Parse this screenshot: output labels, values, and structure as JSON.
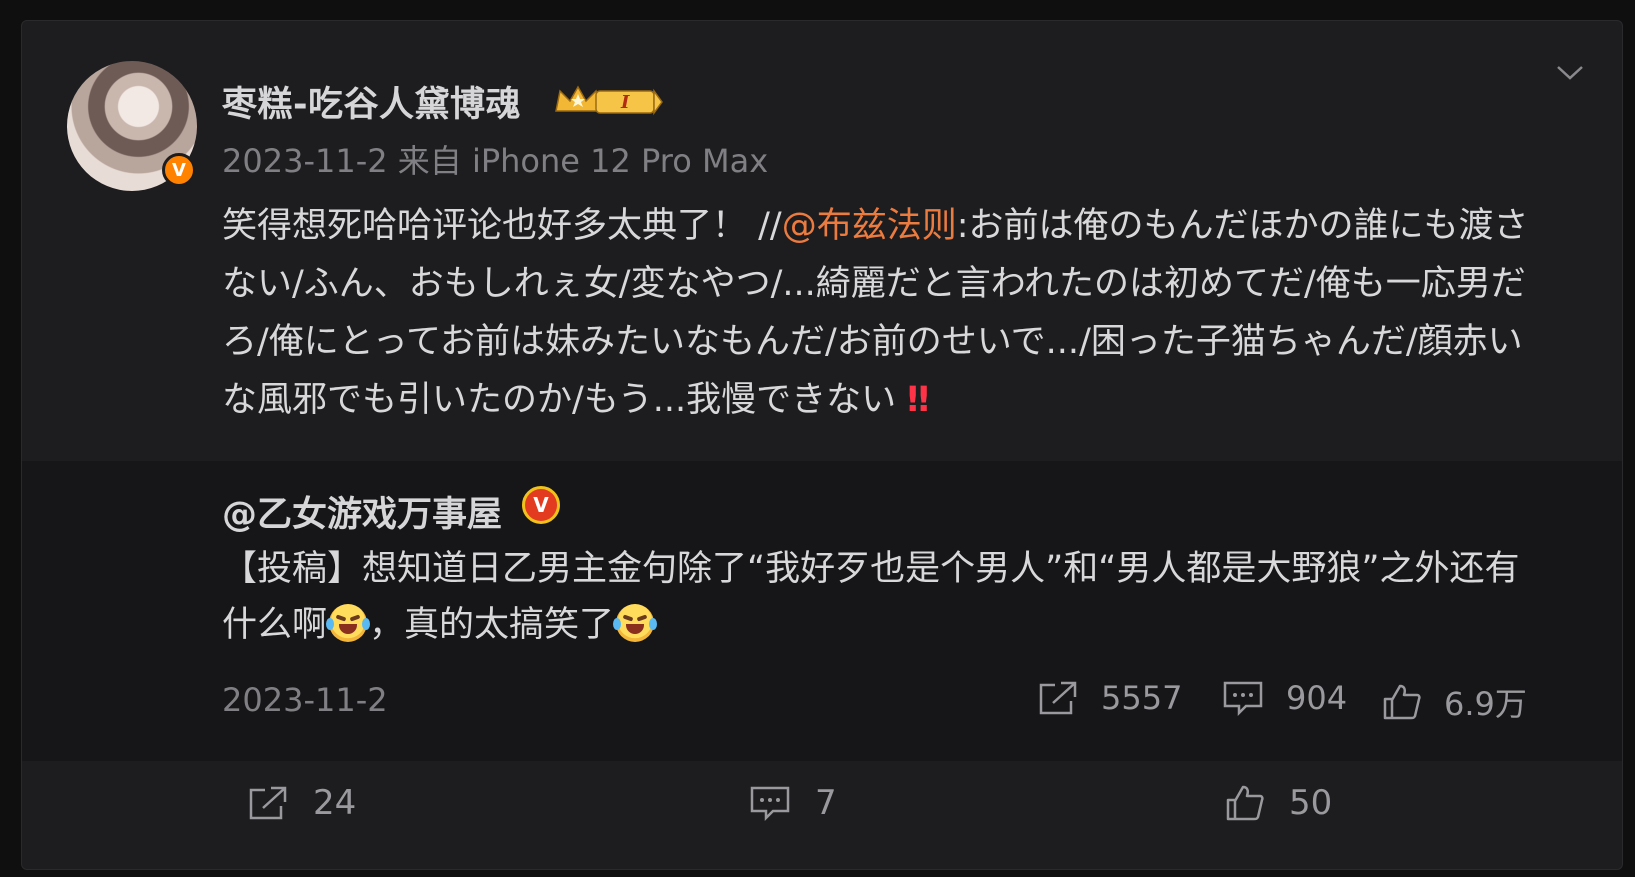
{
  "post": {
    "username": "枣糕-吃谷人黛博魂",
    "meta": "2023-11-2 来自 iPhone 12 Pro Max",
    "text_before": "笑得想死哈哈评论也好多太典了！ //",
    "mention": "@布兹法则",
    "text_after": ":お前は俺のもんだほかの誰にも渡さない/ふん、おもしれぇ女/変なやつ/...綺麗だと言われたのは初めてだ/俺も一応男だろ/俺にとってお前は妹みたいなもんだ/お前のせいで.../困った子猫ちゃんだ/顔赤いな風邪でも引いたのか/もう...我慢できない ",
    "emphasis": "‼"
  },
  "repost": {
    "username": "@乙女游戏万事屋",
    "text_part1": "【投稿】想知道日乙男主金句除了“我好歹也是个男人”和“男人都是大野狼”之外还有什么啊",
    "text_part2": "，真的太搞笑了",
    "date": "2023-11-2",
    "shares": "5557",
    "comments": "904",
    "likes": "6.9万"
  },
  "actions": {
    "shares": "24",
    "comments": "7",
    "likes": "50"
  },
  "icons": [
    "verified-badge-icon",
    "vip-crown-icon",
    "chevron-down-icon",
    "share-icon",
    "comment-icon",
    "like-icon",
    "laughing-emoji-icon"
  ],
  "colors": {
    "mention": "#ec7b3f",
    "verified": "#ff8200",
    "background": "#1d1d1f"
  }
}
